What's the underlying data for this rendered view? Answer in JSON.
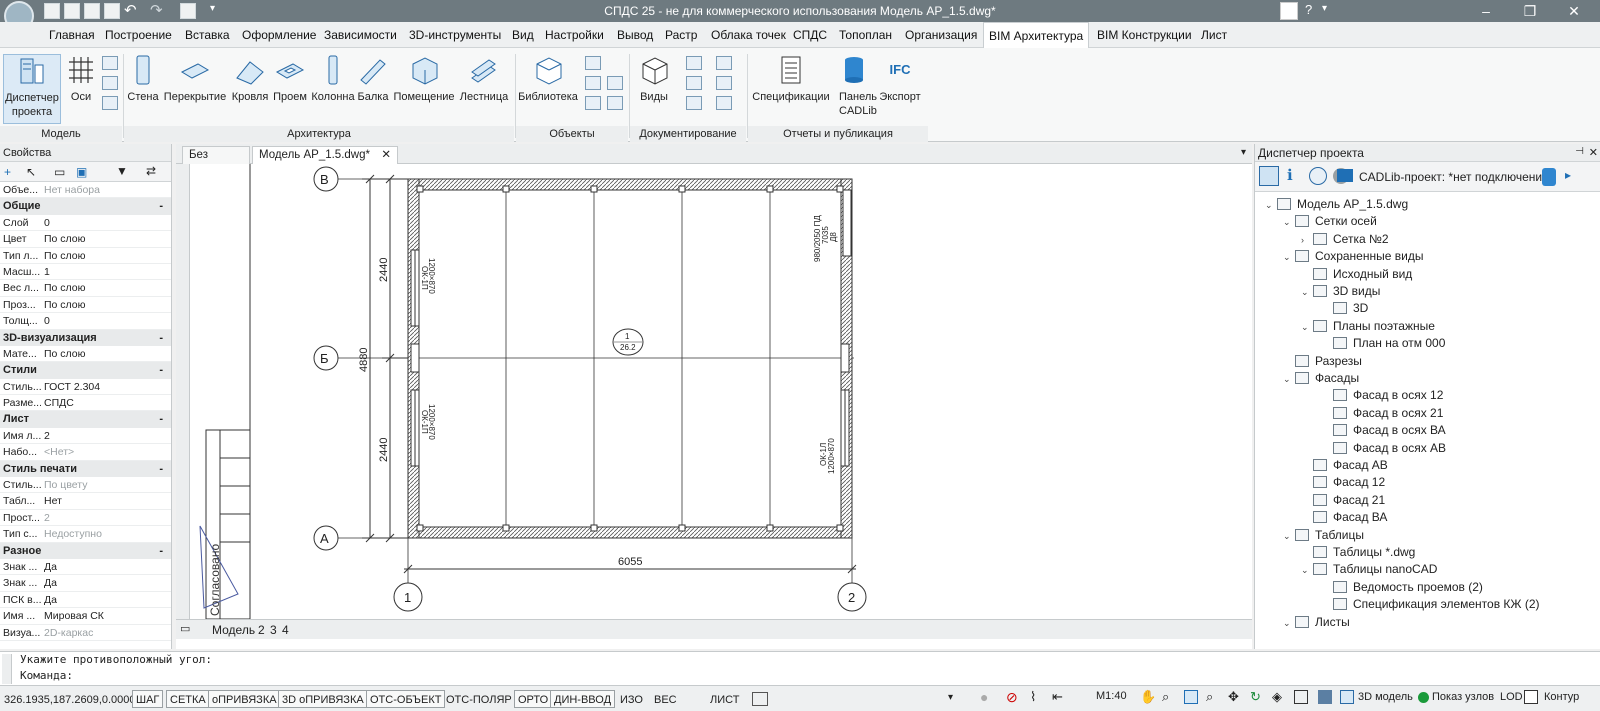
{
  "window": {
    "title": "СПДС 25 - не для коммерческого использования Модель АР_1.5.dwg*"
  },
  "menu": [
    "Главная",
    "Построение",
    "Вставка",
    "Оформление",
    "Зависимости",
    "3D-инструменты",
    "Вид",
    "Настройки",
    "Вывод",
    "Растр",
    "Облака точек",
    "СПДС",
    "Топоплан",
    "Организация",
    "BIM Архитектура",
    "BIM Конструкции",
    "Лист"
  ],
  "ribbon": {
    "model": {
      "label": "Модель",
      "buttons": [
        "Диспетчер проекта",
        "Оси"
      ]
    },
    "arch": {
      "label": "Архитектура",
      "buttons": [
        "Стена",
        "Перекрытие",
        "Кровля",
        "Проем",
        "Колонна",
        "Балка",
        "Помещение",
        "Лестница"
      ]
    },
    "objects": {
      "label": "Объекты",
      "buttons": [
        "Библиотека"
      ]
    },
    "docs": {
      "label": "Документирование",
      "buttons": [
        "Виды"
      ]
    },
    "reports": {
      "label": "Отчеты и публикация",
      "buttons": [
        "Спецификации",
        "Панель CADLib",
        "Экспорт"
      ],
      "ifc": "IFC"
    }
  },
  "properties": {
    "title": "Свойства",
    "object_row": {
      "k": "Объе...",
      "v": "Нет набора"
    },
    "sections": [
      {
        "name": "Общие",
        "rows": [
          [
            "Слой",
            "0"
          ],
          [
            "Цвет",
            "По слою"
          ],
          [
            "Тип л...",
            "По слою"
          ],
          [
            "Масш...",
            "1"
          ],
          [
            "Вес л...",
            "По слою"
          ],
          [
            "Проз...",
            "По слою"
          ],
          [
            "Толщ...",
            "0"
          ]
        ]
      },
      {
        "name": "3D-визуализация",
        "rows": [
          [
            "Мате...",
            "По слою"
          ]
        ]
      },
      {
        "name": "Стили",
        "rows": [
          [
            "Стиль...",
            "ГОСТ 2.304"
          ],
          [
            "Разме...",
            "СПДС"
          ]
        ]
      },
      {
        "name": "Лист",
        "rows": [
          [
            "Имя л...",
            "2"
          ],
          [
            "Набо...",
            "<Нет>"
          ]
        ]
      },
      {
        "name": "Стиль печати",
        "rows": [
          [
            "Стиль...",
            "По цвету"
          ],
          [
            "Табл...",
            "Нет"
          ],
          [
            "Прост...",
            "2"
          ],
          [
            "Тип с...",
            "Недоступно"
          ]
        ]
      },
      {
        "name": "Разное",
        "rows": [
          [
            "Знак ...",
            "Да"
          ],
          [
            "Знак ...",
            "Да"
          ],
          [
            "ПСК в...",
            "Да"
          ],
          [
            "Имя ...",
            "Мировая СК"
          ],
          [
            "Визуа...",
            "2D-каркас"
          ]
        ]
      }
    ]
  },
  "tabs": [
    "Без имени(",
    "Модель АР_1.5.dwg*"
  ],
  "model_tabs": [
    "Модель",
    "2",
    "3",
    "4"
  ],
  "drawing": {
    "axes": {
      "B": "В",
      "Bb": "Б",
      "A": "А",
      "n1": "1",
      "n2": "2"
    },
    "dims": {
      "top": "2440",
      "mid": "4880",
      "bot": "2440",
      "width": "6055"
    },
    "room": {
      "num": "1",
      "area": "26.2"
    },
    "win1": "ОК-1П",
    "win1s": "1200×870",
    "win2": "ОК-1П",
    "win2s": "1200×870",
    "win3": "ОК-1Л",
    "win3s": "1200×870",
    "door": "980/2050 ПД",
    "door2": "7035",
    "door3": "Д8",
    "stamp": "Согласовано"
  },
  "project_manager": {
    "title": "Диспетчер проекта",
    "cadlib": "CADLib-проект:  *нет подключения*",
    "tree": [
      {
        "t": "Модель АР_1.5.dwg",
        "l": 0,
        "ar": "⌄"
      },
      {
        "t": "Сетки осей",
        "l": 1,
        "ar": "⌄"
      },
      {
        "t": "Сетка №2",
        "l": 2,
        "ar": "›"
      },
      {
        "t": "Сохраненные виды",
        "l": 1,
        "ar": "⌄"
      },
      {
        "t": "Исходный вид",
        "l": 2,
        "ar": ""
      },
      {
        "t": "3D виды",
        "l": 2,
        "ar": "⌄"
      },
      {
        "t": "3D",
        "l": 3,
        "ar": ""
      },
      {
        "t": "Планы поэтажные",
        "l": 2,
        "ar": "⌄"
      },
      {
        "t": "План на отм 000",
        "l": 3,
        "ar": ""
      },
      {
        "t": "Разрезы",
        "l": 1,
        "ar": ""
      },
      {
        "t": "Фасады",
        "l": 1,
        "ar": "⌄"
      },
      {
        "t": "Фасад в осях 12",
        "l": 3,
        "ar": ""
      },
      {
        "t": "Фасад в осях 21",
        "l": 3,
        "ar": ""
      },
      {
        "t": "Фасад в осях ВА",
        "l": 3,
        "ar": ""
      },
      {
        "t": "Фасад в осях АВ",
        "l": 3,
        "ar": ""
      },
      {
        "t": "Фасад АВ",
        "l": 2,
        "ar": ""
      },
      {
        "t": "Фасад 12",
        "l": 2,
        "ar": ""
      },
      {
        "t": "Фасад 21",
        "l": 2,
        "ar": ""
      },
      {
        "t": "Фасад ВА",
        "l": 2,
        "ar": ""
      },
      {
        "t": "Таблицы",
        "l": 1,
        "ar": "⌄"
      },
      {
        "t": "Таблицы *.dwg",
        "l": 2,
        "ar": ""
      },
      {
        "t": "Таблицы nanoCAD",
        "l": 2,
        "ar": "⌄"
      },
      {
        "t": "Ведомость проемов (2)",
        "l": 3,
        "ar": ""
      },
      {
        "t": "Спецификация элементов КЖ (2)",
        "l": 3,
        "ar": ""
      },
      {
        "t": "Листы",
        "l": 1,
        "ar": "⌄"
      }
    ]
  },
  "command": {
    "line1": "Укажите противоположный угол:",
    "line2": "Команда:"
  },
  "status": {
    "coords": "326.1935,187.2609,0.0000",
    "buttons": [
      "ШАГ",
      "СЕТКА",
      "оПРИВЯЗКА",
      "3D оПРИВЯЗКА",
      "ОТС-ОБЪЕКТ",
      "ОТС-ПОЛЯР",
      "ОРТО",
      "ДИН-ВВОД",
      "ИЗО",
      "ВЕС"
    ],
    "list": "ЛИСТ",
    "scale": "M1:40",
    "model3d": "3D модель",
    "nodes": "Показ узлов",
    "lod": "LOD",
    "contour": "Контур"
  },
  "colors": {
    "accent": "#1f6fb5",
    "titlebar": "#6e7a80"
  }
}
